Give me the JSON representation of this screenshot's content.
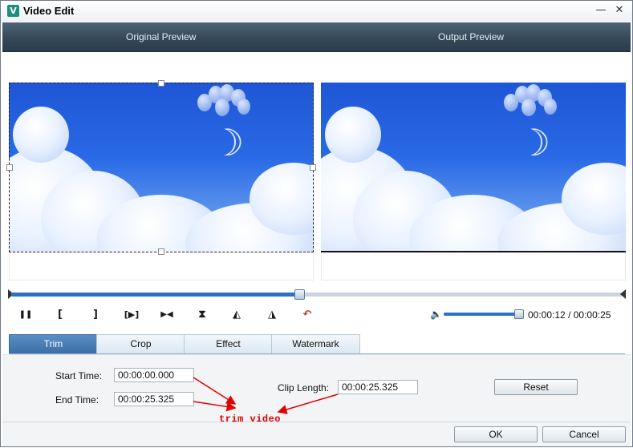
{
  "window": {
    "title": "Video Edit",
    "icon": "app-logo-icon",
    "minimize_glyph": "—",
    "close_glyph": "✕"
  },
  "preview": {
    "original_label": "Original Preview",
    "output_label": "Output Preview",
    "original_moon": "☽",
    "output_moon": "☽"
  },
  "playback": {
    "progress": 0.47,
    "volume": 0.95,
    "current_time": "00:00:12",
    "separator": "/",
    "total_time": "00:00:25",
    "controls": {
      "pause": "❚❚",
      "mark_in": "[",
      "mark_out": "]",
      "play_segment": "[▶]",
      "next_frame": "▶◀",
      "flip_vertical": "⧗",
      "rotate_left": "◭",
      "rotate_right": "◮",
      "undo": "↶"
    },
    "volume_icon": "🔈"
  },
  "tabs": [
    {
      "label": "Trim",
      "active": true
    },
    {
      "label": "Crop",
      "active": false
    },
    {
      "label": "Effect",
      "active": false
    },
    {
      "label": "Watermark",
      "active": false
    }
  ],
  "trim": {
    "start_label": "Start Time:",
    "start_value": "00:00:00.000",
    "end_label": "End Time:",
    "end_value": "00:00:25.325",
    "clip_length_label": "Clip Length:",
    "clip_length_value": "00:00:25.325",
    "reset_label": "Reset"
  },
  "annotation": {
    "text": "trim video",
    "color": "#e00000"
  },
  "footer": {
    "ok_label": "OK",
    "cancel_label": "Cancel"
  },
  "colors": {
    "accent": "#2b71c4",
    "header_dark": "#35495a",
    "active_tab": "#3a6ea6"
  }
}
